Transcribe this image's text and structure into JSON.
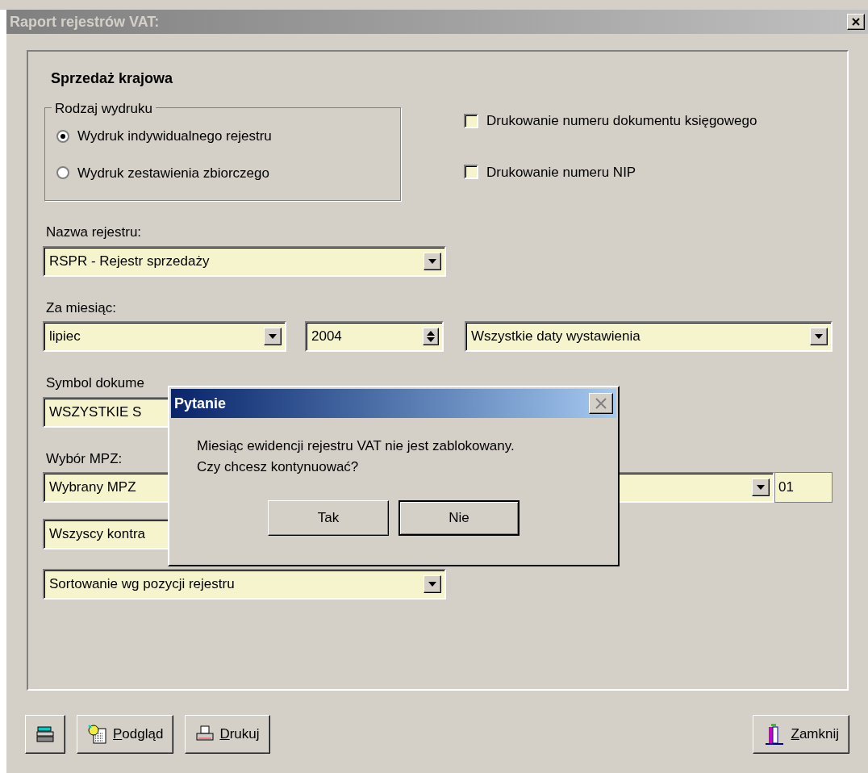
{
  "window": {
    "title": "Raport rejestrów VAT:"
  },
  "section_title": "Sprzedaż krajowa",
  "print_type": {
    "legend": "Rodzaj wydruku",
    "options": [
      {
        "label": "Wydruk indywidualnego rejestru",
        "selected": true
      },
      {
        "label": "Wydruk zestawienia zbiorczego",
        "selected": false
      }
    ]
  },
  "checkboxes": [
    {
      "label": "Drukowanie numeru dokumentu księgowego",
      "checked": false
    },
    {
      "label": "Drukowanie numeru NIP",
      "checked": false
    }
  ],
  "register": {
    "label": "Nazwa rejestru:",
    "value": "RSPR - Rejestr sprzedaży"
  },
  "month": {
    "label": "Za miesiąc:",
    "month": "lipiec",
    "year": "2004",
    "date_filter": "Wszystkie daty wystawienia"
  },
  "document_symbol": {
    "label": "Symbol dokume",
    "value": "WSZYSTKIE S"
  },
  "mpz": {
    "label": "Wybór MPZ:",
    "value": "Wybrany MPZ",
    "code": "01"
  },
  "contractors": {
    "value": "Wszyscy kontra"
  },
  "sorting": {
    "value": "Sortowanie wg pozycji rejestru"
  },
  "buttons": [
    {
      "kind": "icon"
    },
    {
      "kind": "preview",
      "label": "Podgląd"
    },
    {
      "kind": "print",
      "label": "Drukuj"
    },
    {
      "kind": "close",
      "label": "Zamknij"
    }
  ],
  "dialog": {
    "title": "Pytanie",
    "lines": [
      "Miesiąc ewidencji rejestru VAT nie jest zablokowany.",
      "Czy chcesz kontynuować?"
    ],
    "buttons": [
      {
        "label": "Tak",
        "default": false
      },
      {
        "label": "Nie",
        "default": true
      }
    ]
  }
}
